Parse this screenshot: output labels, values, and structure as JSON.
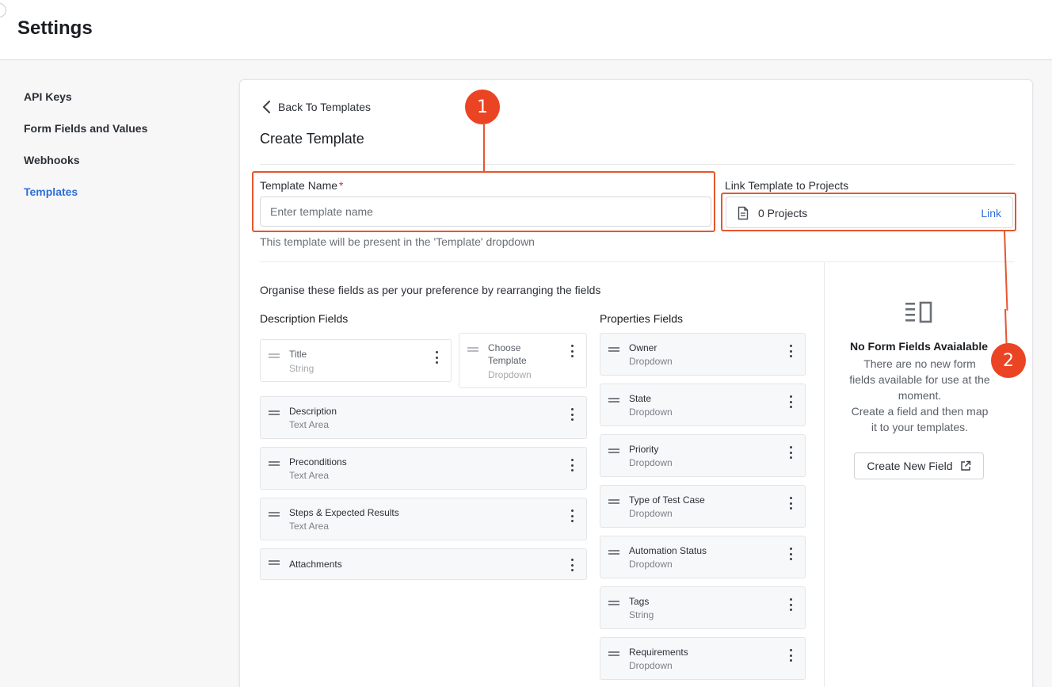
{
  "header": {
    "title": "Settings"
  },
  "sidebar": {
    "items": [
      {
        "label": "API Keys",
        "active": false
      },
      {
        "label": "Form Fields and Values",
        "active": false
      },
      {
        "label": "Webhooks",
        "active": false
      },
      {
        "label": "Templates",
        "active": true
      }
    ]
  },
  "main": {
    "back_label": "Back To Templates",
    "page_title": "Create Template",
    "template_name": {
      "label": "Template Name",
      "required_mark": "*",
      "placeholder": "Enter template name",
      "value": "",
      "hint": "This template will be present in the 'Template' dropdown"
    },
    "link_projects": {
      "label": "Link Template to Projects",
      "count_text": "0 Projects",
      "link_label": "Link"
    },
    "organise_text": "Organise these fields as per your preference by rearranging the fields",
    "description_fields": {
      "title": "Description Fields",
      "title_field": {
        "name": "Title",
        "type": "String"
      },
      "choose_template_field": {
        "name_line1": "Choose",
        "name_line2": "Template",
        "type": "Dropdown"
      },
      "items": [
        {
          "name": "Description",
          "type": "Text Area"
        },
        {
          "name": "Preconditions",
          "type": "Text Area"
        },
        {
          "name": "Steps & Expected Results",
          "type": "Text Area"
        },
        {
          "name": "Attachments",
          "type": ""
        }
      ]
    },
    "properties_fields": {
      "title": "Properties Fields",
      "items": [
        {
          "name": "Owner",
          "type": "Dropdown"
        },
        {
          "name": "State",
          "type": "Dropdown"
        },
        {
          "name": "Priority",
          "type": "Dropdown"
        },
        {
          "name": "Type of Test Case",
          "type": "Dropdown"
        },
        {
          "name": "Automation Status",
          "type": "Dropdown"
        },
        {
          "name": "Tags",
          "type": "String"
        },
        {
          "name": "Requirements",
          "type": "Dropdown"
        }
      ]
    },
    "empty_state": {
      "title": "No Form Fields Avaialable",
      "line1": "There are no new form",
      "line2": "fields available for use at the",
      "line3": "moment.",
      "line4": "Create a field and then map",
      "line5": "it to your templates.",
      "button_label": "Create New Field"
    }
  },
  "annotations": {
    "badge1": "1",
    "badge2": "2",
    "color": "#ea4424"
  },
  "colors": {
    "accent": "#2f6fd6",
    "annotation": "#e4572e"
  }
}
